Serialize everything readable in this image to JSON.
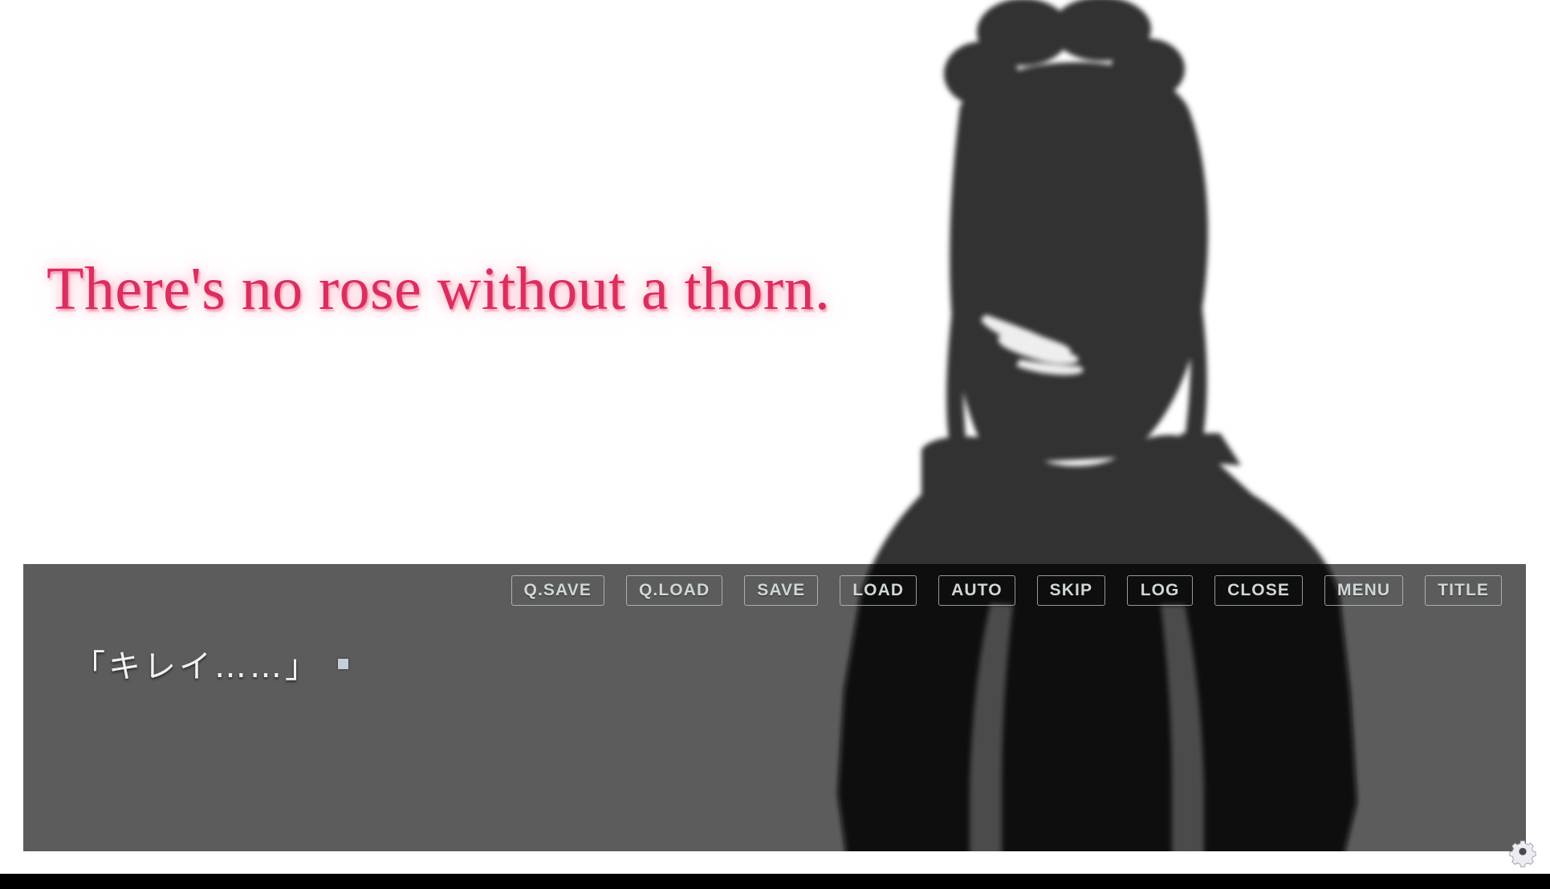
{
  "scene": {
    "background_color": "#ffffff",
    "letterbox_color": "#000000",
    "character": {
      "name": "heroine-silhouette",
      "description": "back view of a girl with twin hair buns",
      "fill_color": "#333333"
    }
  },
  "narration": {
    "text": "There's no rose without a thorn.",
    "color": "#dd2d5e"
  },
  "dialogue": {
    "box_color": "#4d4d4d",
    "text": "「キレイ……」",
    "text_color": "#f2f2f2",
    "cursor_icon": "click-to-continue-square"
  },
  "command_bar": {
    "buttons": [
      {
        "id": "qsave",
        "label": "Q.SAVE"
      },
      {
        "id": "qload",
        "label": "Q.LOAD"
      },
      {
        "id": "save",
        "label": "SAVE"
      },
      {
        "id": "load",
        "label": "LOAD"
      },
      {
        "id": "auto",
        "label": "AUTO"
      },
      {
        "id": "skip",
        "label": "SKIP"
      },
      {
        "id": "log",
        "label": "LOG"
      },
      {
        "id": "close",
        "label": "CLOSE"
      },
      {
        "id": "menu",
        "label": "MENU"
      },
      {
        "id": "title",
        "label": "TITLE"
      }
    ],
    "text_color": "#cfd7d9",
    "border_color": "#c8d2d4"
  },
  "config": {
    "icon": "gear-icon",
    "icon_color": "#e8e8ef"
  }
}
